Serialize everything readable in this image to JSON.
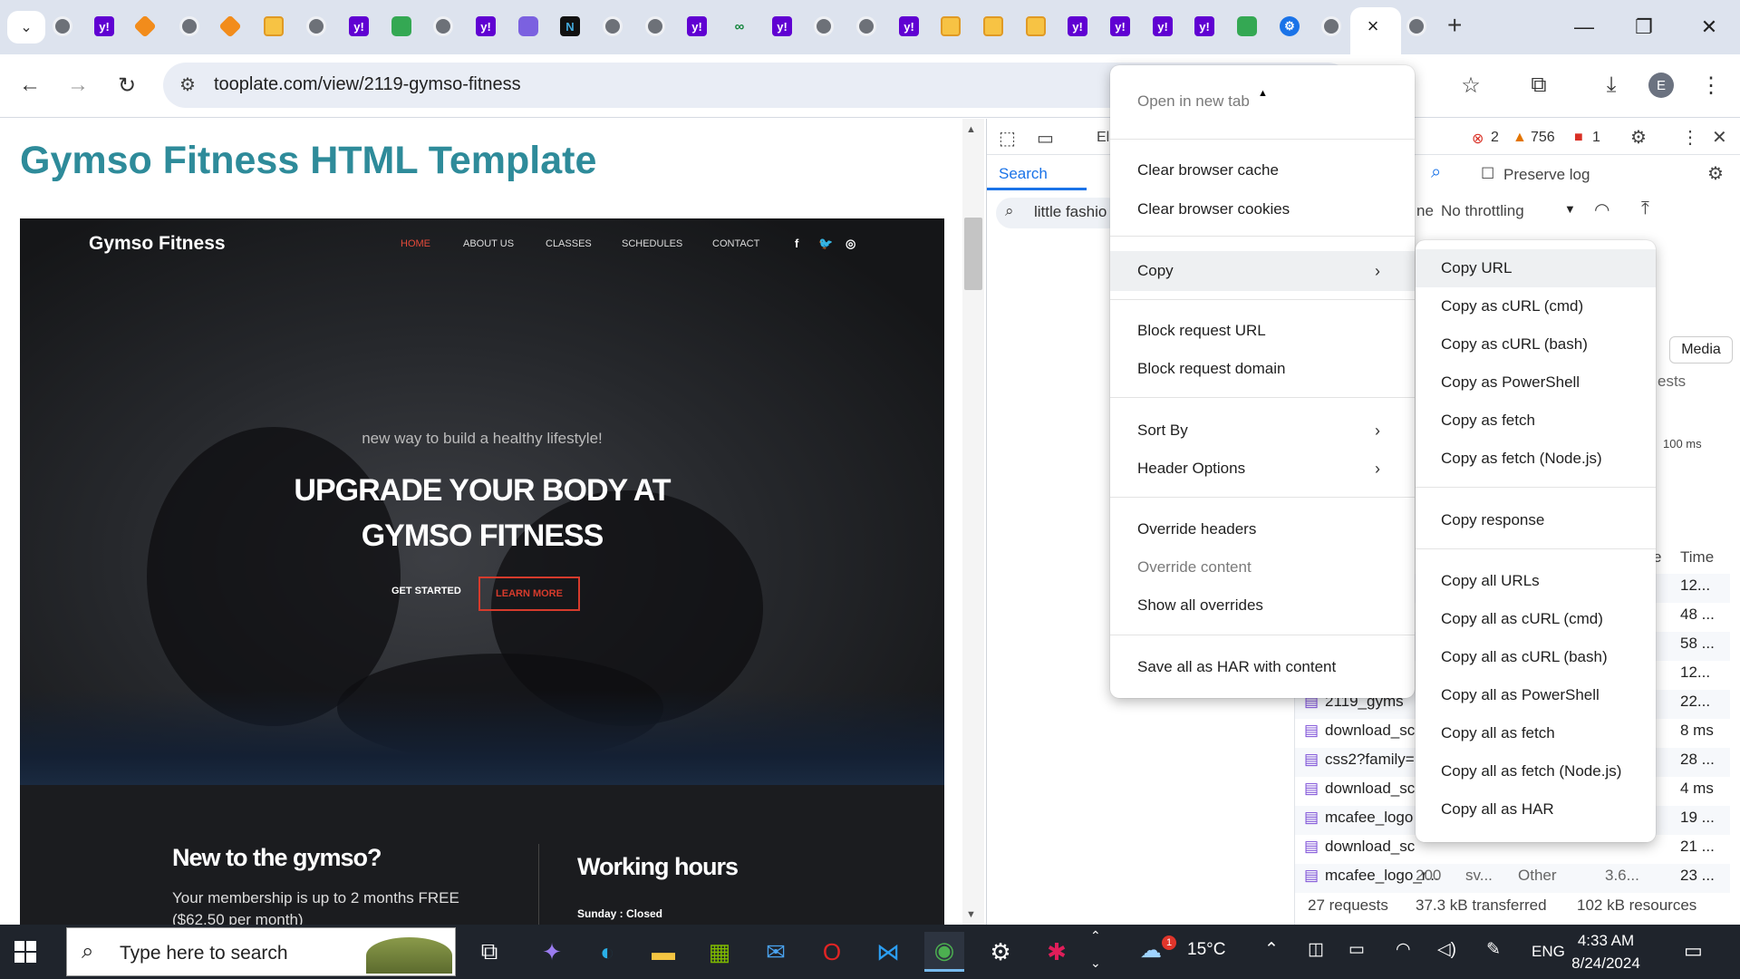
{
  "tabstrip": {
    "tab_favicons": [
      "globe-icon",
      "yahoo-icon",
      "orange-cube-icon",
      "globe-icon",
      "orange-cube-icon",
      "books-icon",
      "globe-icon",
      "yahoo-icon",
      "meet-icon",
      "globe-icon",
      "yahoo-icon",
      "purple-app-icon",
      "ai-icon",
      "globe-icon",
      "globe-icon",
      "yahoo-icon",
      "green-link-icon",
      "yahoo-icon",
      "globe-icon",
      "globe-icon",
      "yahoo-icon",
      "orange-stack-icon",
      "books-icon",
      "books-icon",
      "yahoo-icon",
      "yahoo-icon",
      "yahoo-icon",
      "yahoo-icon",
      "meet-icon",
      "gear-icon",
      "globe-icon"
    ],
    "active_close": "×",
    "newtab": "+"
  },
  "window": {
    "minimize": "—",
    "restore": "❐",
    "close": "✕"
  },
  "address_bar": {
    "url": "tooplate.com/view/2119-gymso-fitness"
  },
  "page": {
    "title": "Gymso Fitness HTML Template",
    "hero": {
      "brand": "Gymso Fitness",
      "nav": [
        "HOME",
        "ABOUT US",
        "CLASSES",
        "SCHEDULES",
        "CONTACT"
      ],
      "social": [
        "f",
        "🐦",
        "◎"
      ],
      "tagline": "new way to build a healthy lifestyle!",
      "headline_1": "UPGRADE YOUR BODY AT",
      "headline_2": "GYMSO FITNESS",
      "btn_start": "GET STARTED",
      "btn_learn": "LEARN MORE",
      "section_left_title": "New to the gymso?",
      "section_left_line1": "Your membership is up to 2 months FREE",
      "section_left_line2": "($62.50 per month)",
      "section_right_title": "Working hours",
      "section_right_line": "Sunday : Closed"
    }
  },
  "devtools": {
    "tab_elements_partial": "El",
    "errors": "2",
    "warnings": "756",
    "issues": "1",
    "search_tab": "Search",
    "search_value": "little fashio",
    "preserve_log": "Preserve log",
    "throttle_prefix": "ne",
    "throttling": "No throttling",
    "filter_media": "Media",
    "partial_requests": "ests",
    "timeline_100": "100 ms",
    "col_e": "e",
    "col_time": "Time",
    "rows": [
      {
        "name": "",
        "time": "12..."
      },
      {
        "name": "",
        "time": "48 ..."
      },
      {
        "name": "",
        "time": "58 ..."
      },
      {
        "name": "",
        "time": "12..."
      },
      {
        "name": "2119_gyms",
        "time": "22..."
      },
      {
        "name": "download_sc",
        "time": "8 ms"
      },
      {
        "name": "css2?family=",
        "time": "28 ..."
      },
      {
        "name": "download_sc",
        "time": "4 ms"
      },
      {
        "name": "mcafee_logo",
        "time": "19 ..."
      },
      {
        "name": "download_sc",
        "time": "21 ..."
      },
      {
        "name": "mcafee_logo_r...",
        "status": "200",
        "type": "sv...",
        "initiator": "Other",
        "size": "3.6...",
        "time": "23 ..."
      }
    ],
    "status_requests": "27 requests",
    "status_transferred": "37.3 kB transferred",
    "status_resources": "102 kB resources"
  },
  "context_menu": {
    "partial_top": "Open in new tab",
    "items": [
      {
        "label": "Clear browser cache"
      },
      {
        "label": "Clear browser cookies"
      },
      {
        "label": "Copy"
      },
      {
        "label": "Block request URL"
      },
      {
        "label": "Block request domain"
      },
      {
        "label": "Sort By"
      },
      {
        "label": "Header Options"
      },
      {
        "label": "Override headers"
      },
      {
        "label": "Override content"
      },
      {
        "label": "Show all overrides"
      },
      {
        "label": "Save all as HAR with content"
      }
    ]
  },
  "copy_submenu": {
    "items": [
      {
        "label": "Copy URL"
      },
      {
        "label": "Copy as cURL (cmd)"
      },
      {
        "label": "Copy as cURL (bash)"
      },
      {
        "label": "Copy as PowerShell"
      },
      {
        "label": "Copy as fetch"
      },
      {
        "label": "Copy as fetch (Node.js)"
      },
      {
        "label": "Copy response"
      },
      {
        "label": "Copy all URLs"
      },
      {
        "label": "Copy all as cURL (cmd)"
      },
      {
        "label": "Copy all as cURL (bash)"
      },
      {
        "label": "Copy all as PowerShell"
      },
      {
        "label": "Copy all as fetch"
      },
      {
        "label": "Copy all as fetch (Node.js)"
      },
      {
        "label": "Copy all as HAR"
      }
    ]
  },
  "taskbar": {
    "search_placeholder": "Type here to search",
    "weather": "15°C",
    "weather_badge": "1",
    "language": "ENG",
    "time": "4:33 AM",
    "date": "8/24/2024",
    "notification_count": "1"
  },
  "colors": {
    "accent_blue": "#1a73e8",
    "page_title_teal": "#2e8b9a",
    "hero_red": "#d63b2c"
  }
}
